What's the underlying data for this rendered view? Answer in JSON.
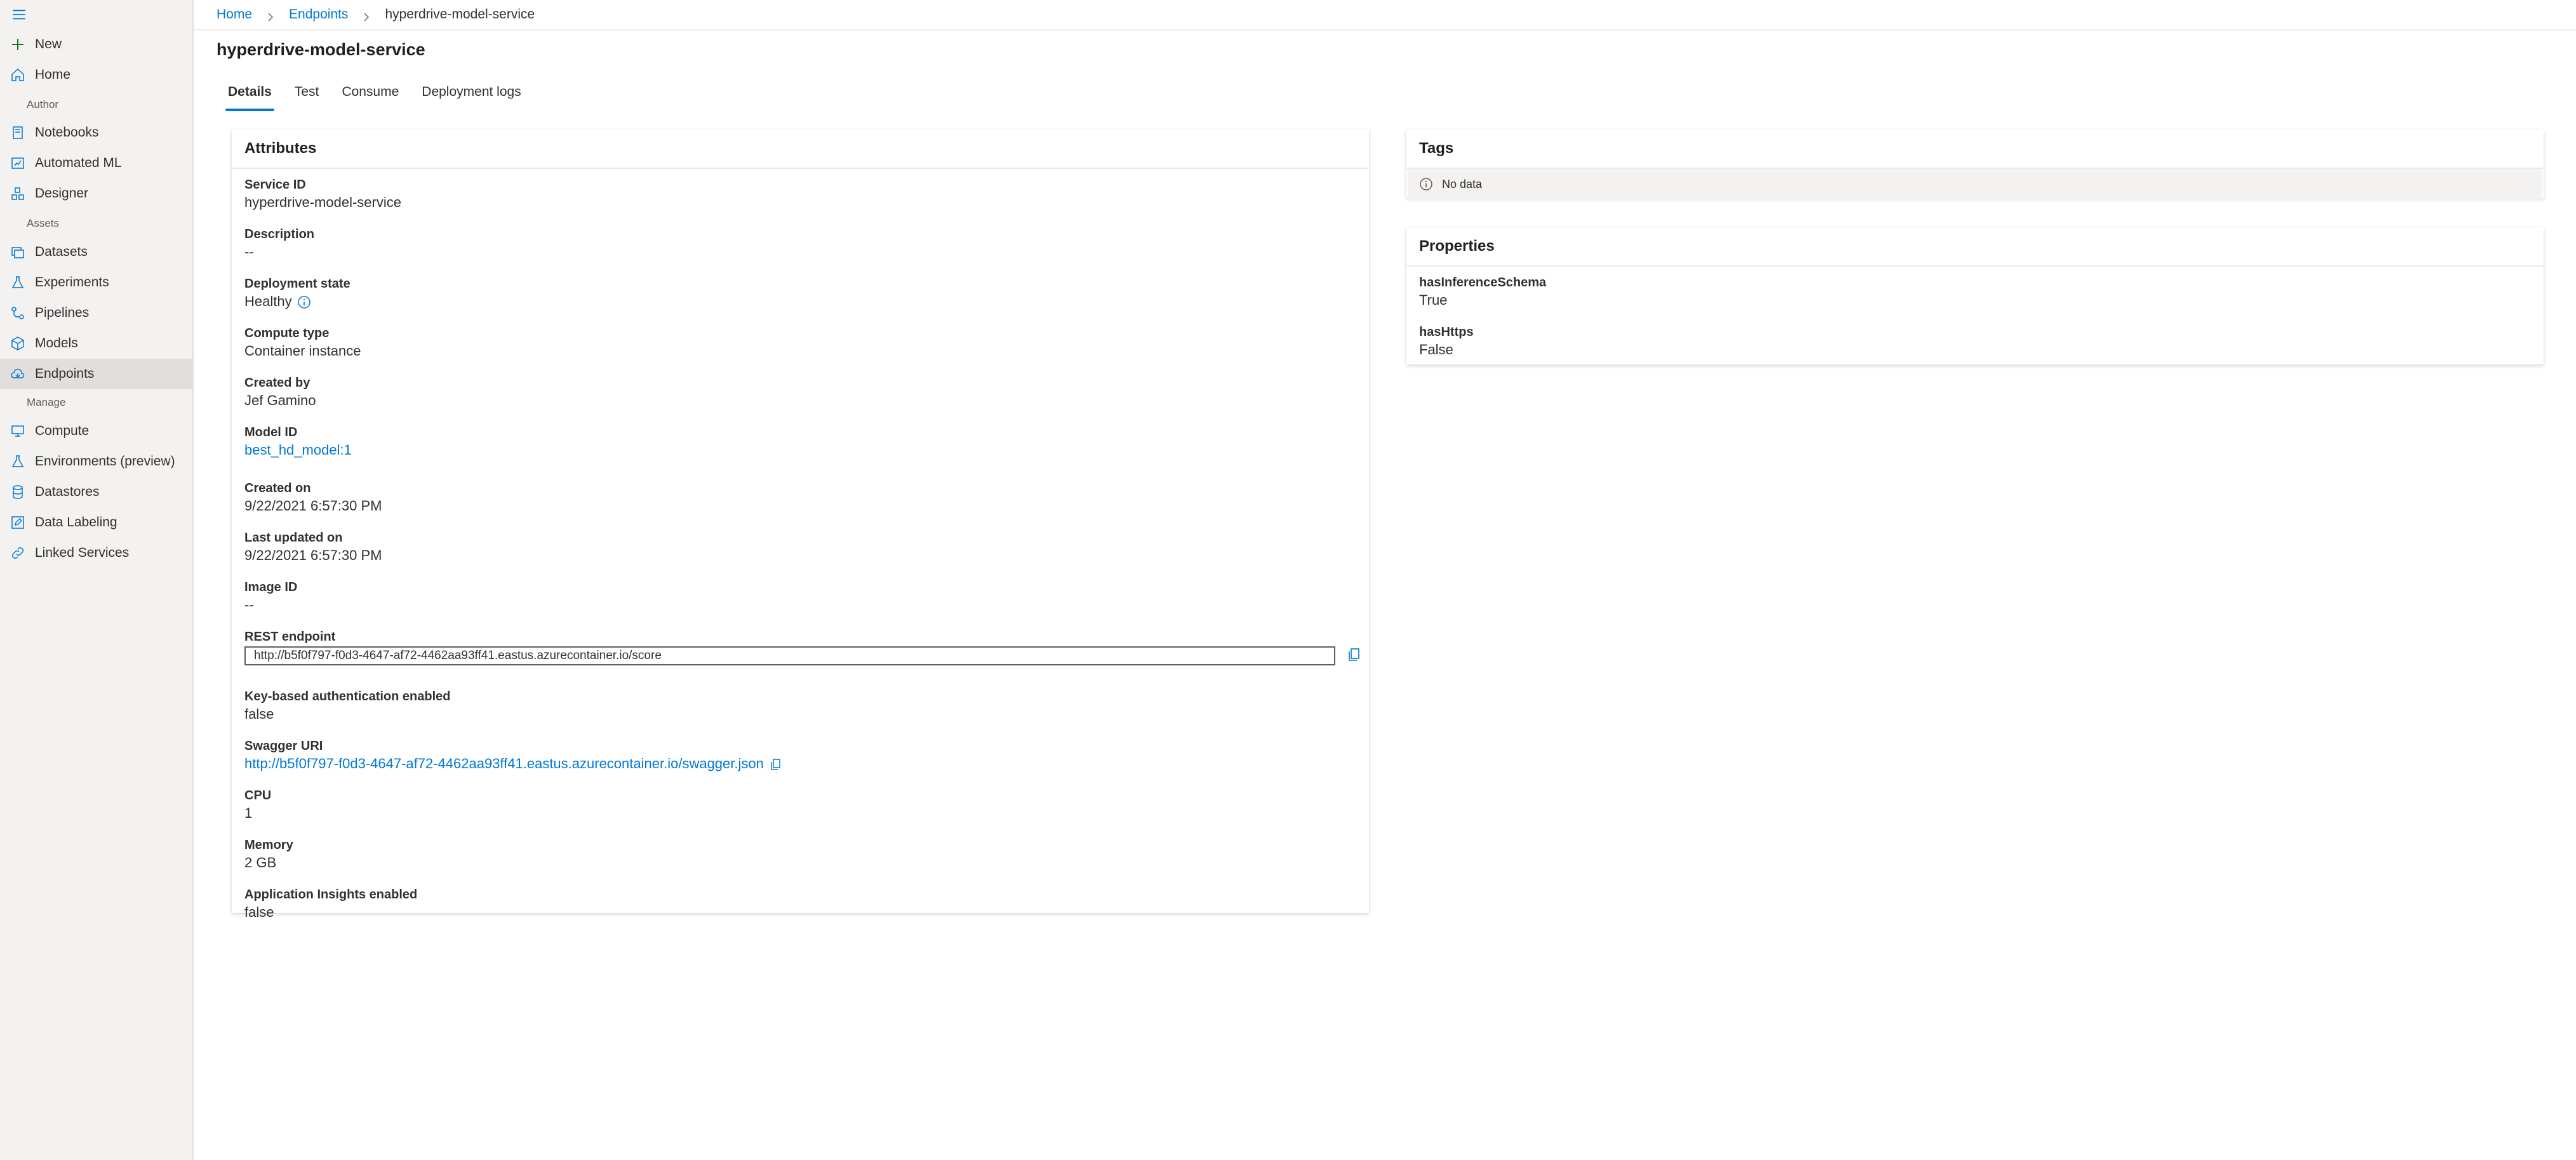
{
  "sidebar": {
    "menu_icon": "hamburger-icon",
    "items": [
      {
        "label": "New",
        "icon": "plus-icon"
      },
      {
        "label": "Home",
        "icon": "home-icon"
      },
      {
        "label": "Notebooks",
        "icon": "notebook-icon"
      },
      {
        "label": "Automated ML",
        "icon": "automl-icon"
      },
      {
        "label": "Designer",
        "icon": "designer-icon"
      },
      {
        "label": "Datasets",
        "icon": "dataset-icon"
      },
      {
        "label": "Experiments",
        "icon": "flask-icon"
      },
      {
        "label": "Pipelines",
        "icon": "pipeline-icon"
      },
      {
        "label": "Models",
        "icon": "cube-icon"
      },
      {
        "label": "Endpoints",
        "icon": "endpoint-icon"
      },
      {
        "label": "Compute",
        "icon": "monitor-icon"
      },
      {
        "label": "Environments (preview)",
        "icon": "flask-icon"
      },
      {
        "label": "Datastores",
        "icon": "database-icon"
      },
      {
        "label": "Data Labeling",
        "icon": "edit-icon"
      },
      {
        "label": "Linked Services",
        "icon": "link-icon"
      }
    ],
    "groups": {
      "author": "Author",
      "assets": "Assets",
      "manage": "Manage"
    }
  },
  "breadcrumb": {
    "home": "Home",
    "endpoints": "Endpoints",
    "current": "hyperdrive-model-service"
  },
  "page": {
    "title": "hyperdrive-model-service"
  },
  "tabs": [
    "Details",
    "Test",
    "Consume",
    "Deployment logs"
  ],
  "attributes": {
    "title": "Attributes",
    "service_id": {
      "label": "Service ID",
      "value": "hyperdrive-model-service"
    },
    "description": {
      "label": "Description",
      "value": "--"
    },
    "deployment_state": {
      "label": "Deployment state",
      "value": "Healthy"
    },
    "compute_type": {
      "label": "Compute type",
      "value": "Container instance"
    },
    "created_by": {
      "label": "Created by",
      "value": "Jef Gamino"
    },
    "model_id": {
      "label": "Model ID",
      "value": "best_hd_model:1"
    },
    "created_on": {
      "label": "Created on",
      "value": "9/22/2021 6:57:30 PM"
    },
    "last_updated_on": {
      "label": "Last updated on",
      "value": "9/22/2021 6:57:30 PM"
    },
    "image_id": {
      "label": "Image ID",
      "value": "--"
    },
    "rest_endpoint": {
      "label": "REST endpoint",
      "value": "http://b5f0f797-f0d3-4647-af72-4462aa93ff41.eastus.azurecontainer.io/score"
    },
    "key_auth": {
      "label": "Key-based authentication enabled",
      "value": "false"
    },
    "swagger_uri": {
      "label": "Swagger URI",
      "value": "http://b5f0f797-f0d3-4647-af72-4462aa93ff41.eastus.azurecontainer.io/swagger.json"
    },
    "cpu": {
      "label": "CPU",
      "value": "1"
    },
    "memory": {
      "label": "Memory",
      "value": "2 GB"
    },
    "app_insights": {
      "label": "Application Insights enabled",
      "value": "false"
    }
  },
  "tags": {
    "title": "Tags",
    "empty_text": "No data"
  },
  "properties": {
    "title": "Properties",
    "items": [
      {
        "label": "hasInferenceSchema",
        "value": "True"
      },
      {
        "label": "hasHttps",
        "value": "False"
      }
    ]
  },
  "colors": {
    "accent": "#0078d4",
    "sidebar_bg": "#f3f2f1",
    "selected_bg": "#e1dfdd",
    "new_plus": "#107c10"
  }
}
